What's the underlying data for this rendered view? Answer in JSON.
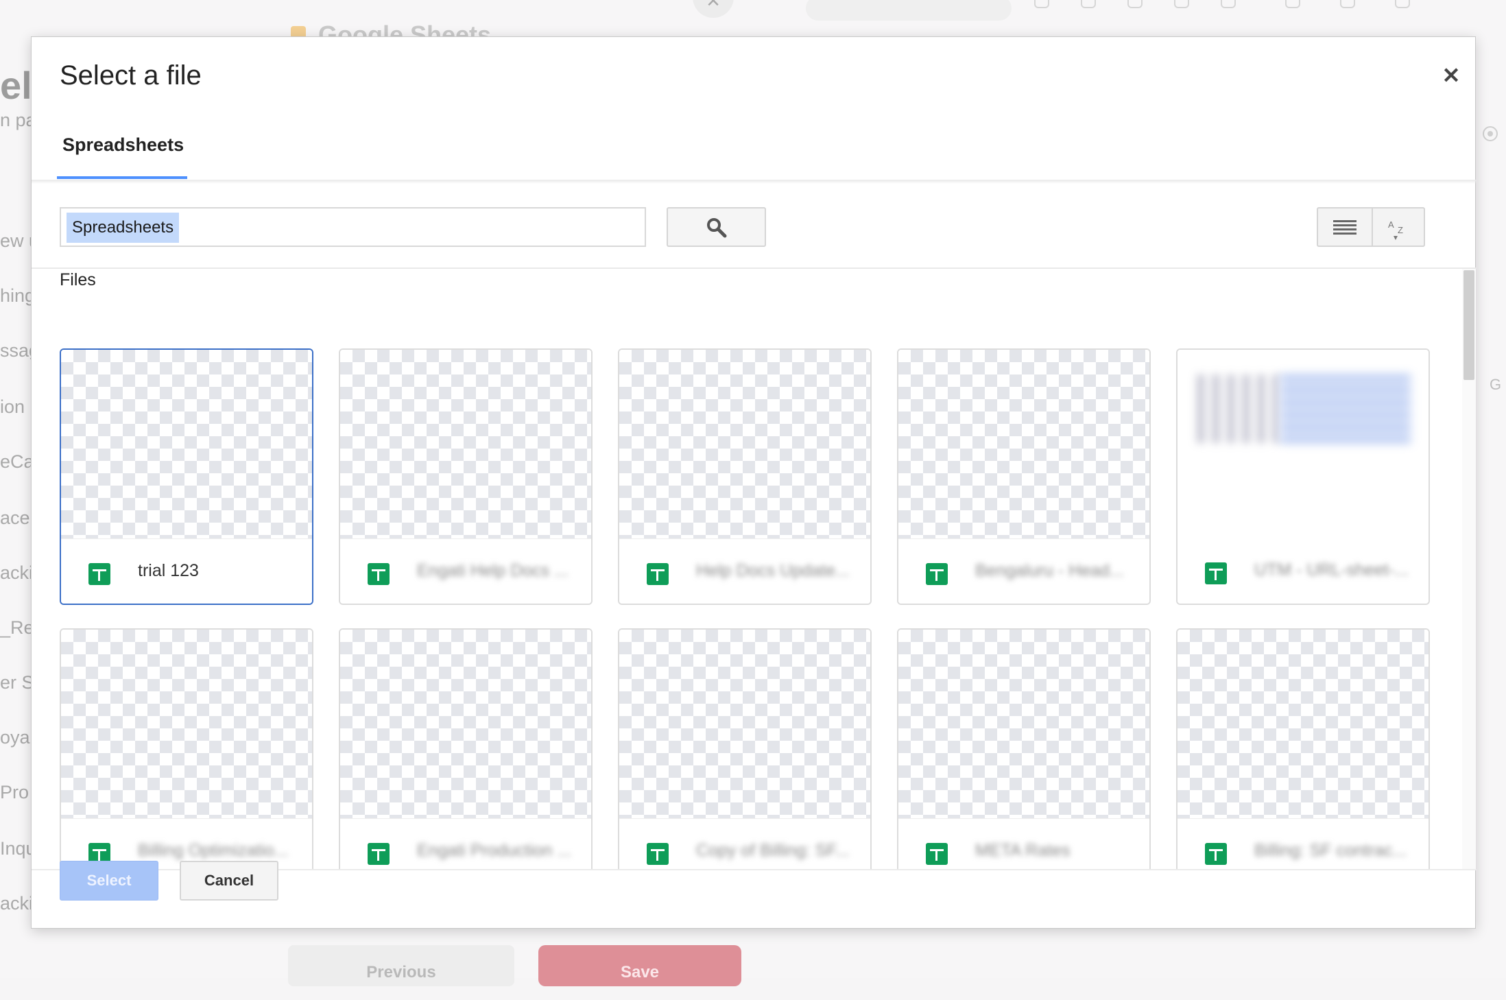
{
  "background": {
    "app_title": "Google Sheets",
    "sidebar_heading": "el",
    "sidebar_items": [
      "n pa",
      "ew u",
      "hing",
      "ssag",
      "ion",
      "eCa",
      "acer",
      "acki",
      "_Rep",
      "er Su",
      "oya",
      "Pro",
      "Inqu",
      "acki"
    ],
    "right_label": "G",
    "previous_label": "Previous",
    "save_label": "Save"
  },
  "dialog": {
    "title": "Select a file",
    "close_icon": "close-icon",
    "tabs": [
      {
        "label": "Spreadsheets",
        "active": true
      }
    ],
    "search": {
      "value": "Spreadsheets"
    },
    "section_label": "Files",
    "files": [
      {
        "name": "trial 123",
        "selected": true,
        "icon": "google-sheets-icon"
      },
      {
        "name": "Engati Help Docs ...",
        "icon": "google-sheets-icon"
      },
      {
        "name": "Help Docs Update...",
        "icon": "google-sheets-icon"
      },
      {
        "name": "Bengaluru - Head...",
        "icon": "google-sheets-icon"
      },
      {
        "name": "UTM - URL-sheet-...",
        "icon": "google-sheets-icon",
        "has_preview": true
      },
      {
        "name": "Billing Optimizatio...",
        "icon": "google-sheets-icon"
      },
      {
        "name": "Engati Production ...",
        "icon": "google-sheets-icon"
      },
      {
        "name": "Copy of Billing: SF...",
        "icon": "google-sheets-icon"
      },
      {
        "name": "META Rates",
        "icon": "google-sheets-icon"
      },
      {
        "name": "Billing: SF contrac...",
        "icon": "google-sheets-icon"
      }
    ],
    "actions": {
      "select_label": "Select",
      "cancel_label": "Cancel"
    },
    "colors": {
      "accent": "#4d90fe",
      "selected_border": "#3b6fc7",
      "sheets_green": "#0f9d58",
      "select_disabled": "#a7c4f8"
    }
  }
}
